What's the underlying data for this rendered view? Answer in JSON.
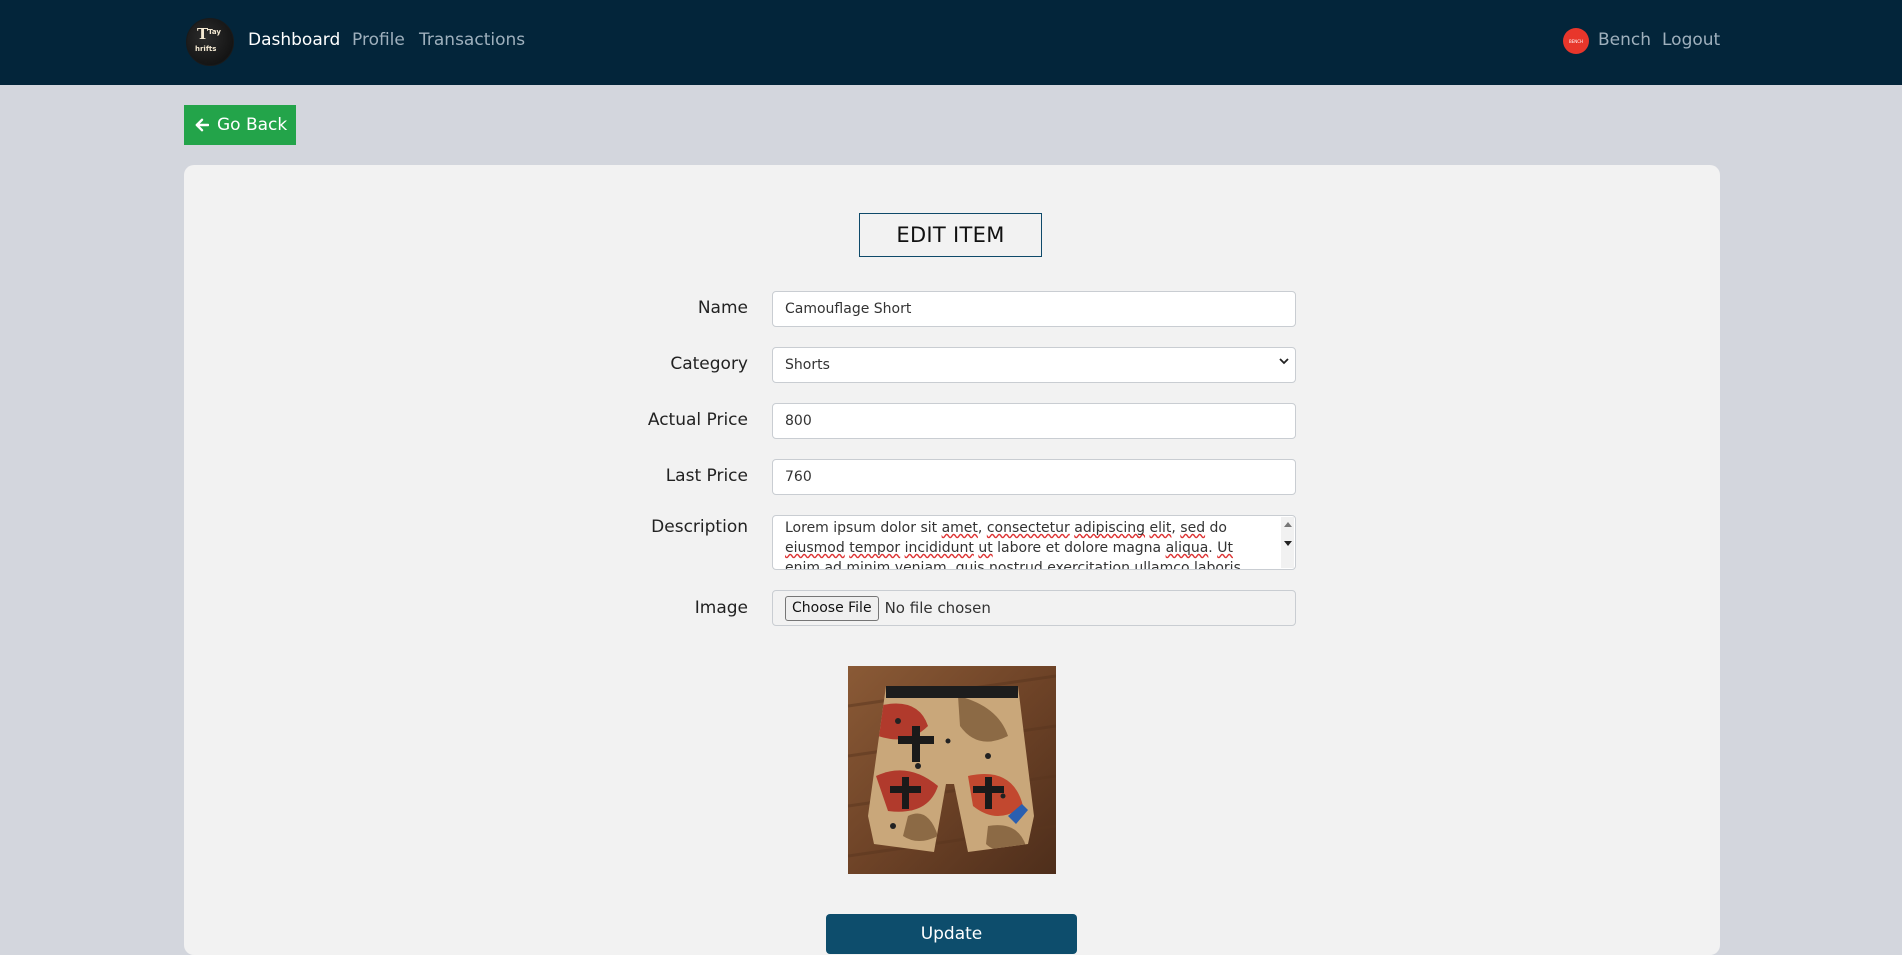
{
  "nav": {
    "logo_text": [
      "T",
      "hrifts",
      "Tay"
    ],
    "links": [
      "Dashboard",
      "Profile",
      "Transactions"
    ],
    "active": "Dashboard",
    "user_name": "Bench",
    "avatar_text": "BENCH",
    "logout": "Logout"
  },
  "go_back": "Go Back",
  "form": {
    "title": "EDIT ITEM",
    "name_label": "Name",
    "name_value": "Camouflage Short",
    "category_label": "Category",
    "category_value": "Shorts",
    "actual_price_label": "Actual Price",
    "actual_price_value": "800",
    "last_price_label": "Last Price",
    "last_price_value": "760",
    "description_label": "Description",
    "description_value": "Lorem ipsum dolor sit amet, consectetur adipiscing elit, sed do eiusmod tempor incididunt ut labore et dolore magna aliqua. Ut enim ad minim veniam, quis nostrud exercitation ullamco laboris",
    "image_label": "Image",
    "file_button": "Choose File",
    "file_status": "No file chosen",
    "update_button": "Update"
  },
  "colors": {
    "navbar": "#03253a",
    "go_back": "#23a44a",
    "update": "#0d4d6c",
    "avatar": "#e8362b"
  }
}
